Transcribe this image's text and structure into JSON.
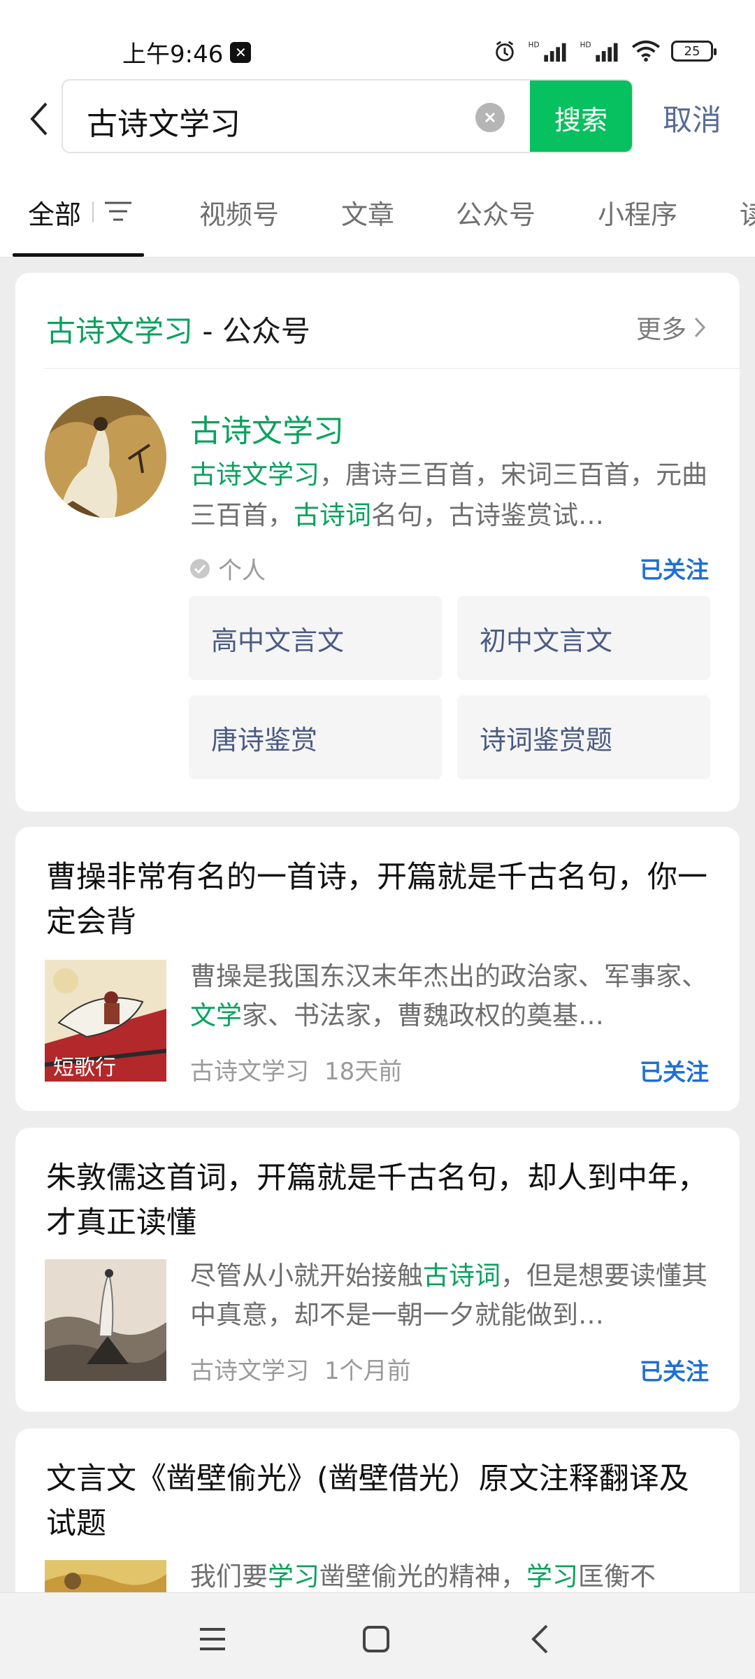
{
  "status": {
    "time": "上午9:46",
    "battery": "25",
    "signal_labels": [
      "HD",
      "HD"
    ]
  },
  "search": {
    "query": "古诗文学习",
    "button": "搜索",
    "cancel": "取消"
  },
  "tabs": [
    "全部",
    "视频号",
    "文章",
    "公众号",
    "小程序",
    "读"
  ],
  "account_card": {
    "header_name": "古诗文学习",
    "header_suffix": " - 公众号",
    "more": "更多",
    "name": "古诗文学习",
    "desc_parts": [
      {
        "t": "古诗文学习",
        "hl": true
      },
      {
        "t": "，唐诗三百首，宋词三百首，元曲三百首，",
        "hl": false
      },
      {
        "t": "古诗词",
        "hl": true
      },
      {
        "t": "名句，古诗鉴赏试…",
        "hl": false
      }
    ],
    "type": "个人",
    "follow_status": "已关注",
    "menus": [
      "高中文言文",
      "初中文言文",
      "唐诗鉴赏",
      "诗词鉴赏题"
    ]
  },
  "articles": [
    {
      "title": "曹操非常有名的一首诗，开篇就是千古名句，你一定会背",
      "thumb_text": "短歌行",
      "desc_parts": [
        {
          "t": "曹操是我国东汉末年杰出的政治家、军事家、",
          "hl": false
        },
        {
          "t": "文学",
          "hl": true
        },
        {
          "t": "家、书法家，曹魏政权的奠基…",
          "hl": false
        }
      ],
      "source": "古诗文学习",
      "time": "18天前",
      "follow_status": "已关注"
    },
    {
      "title": "朱敦儒这首词，开篇就是千古名句，却人到中年，才真正读懂",
      "thumb_text": "",
      "desc_parts": [
        {
          "t": "尽管从小就开始接触",
          "hl": false
        },
        {
          "t": "古诗词",
          "hl": true
        },
        {
          "t": "，但是想要读懂其中真意，却不是一朝一夕就能做到…",
          "hl": false
        }
      ],
      "source": "古诗文学习",
      "time": "1个月前",
      "follow_status": "已关注"
    },
    {
      "title": "文言文《凿壁偷光》(凿壁借光）原文注释翻译及试题",
      "thumb_text": "",
      "desc_parts": [
        {
          "t": "我们要",
          "hl": false
        },
        {
          "t": "学习",
          "hl": true
        },
        {
          "t": "凿壁偷光的精神，",
          "hl": false
        },
        {
          "t": "学习",
          "hl": true
        },
        {
          "t": "匡衡不",
          "hl": false
        }
      ],
      "source": "",
      "time": "",
      "follow_status": ""
    }
  ],
  "colors": {
    "brand_green": "#07c160",
    "highlight_green": "#07a25c",
    "link_blue": "#576b95",
    "follow_blue": "#1f6fd6"
  },
  "icons": [
    "back-arrow-icon",
    "clear-icon",
    "filter-icon",
    "chevron-right-icon",
    "verified-icon",
    "menu-icon",
    "home-icon",
    "nav-back-icon"
  ]
}
